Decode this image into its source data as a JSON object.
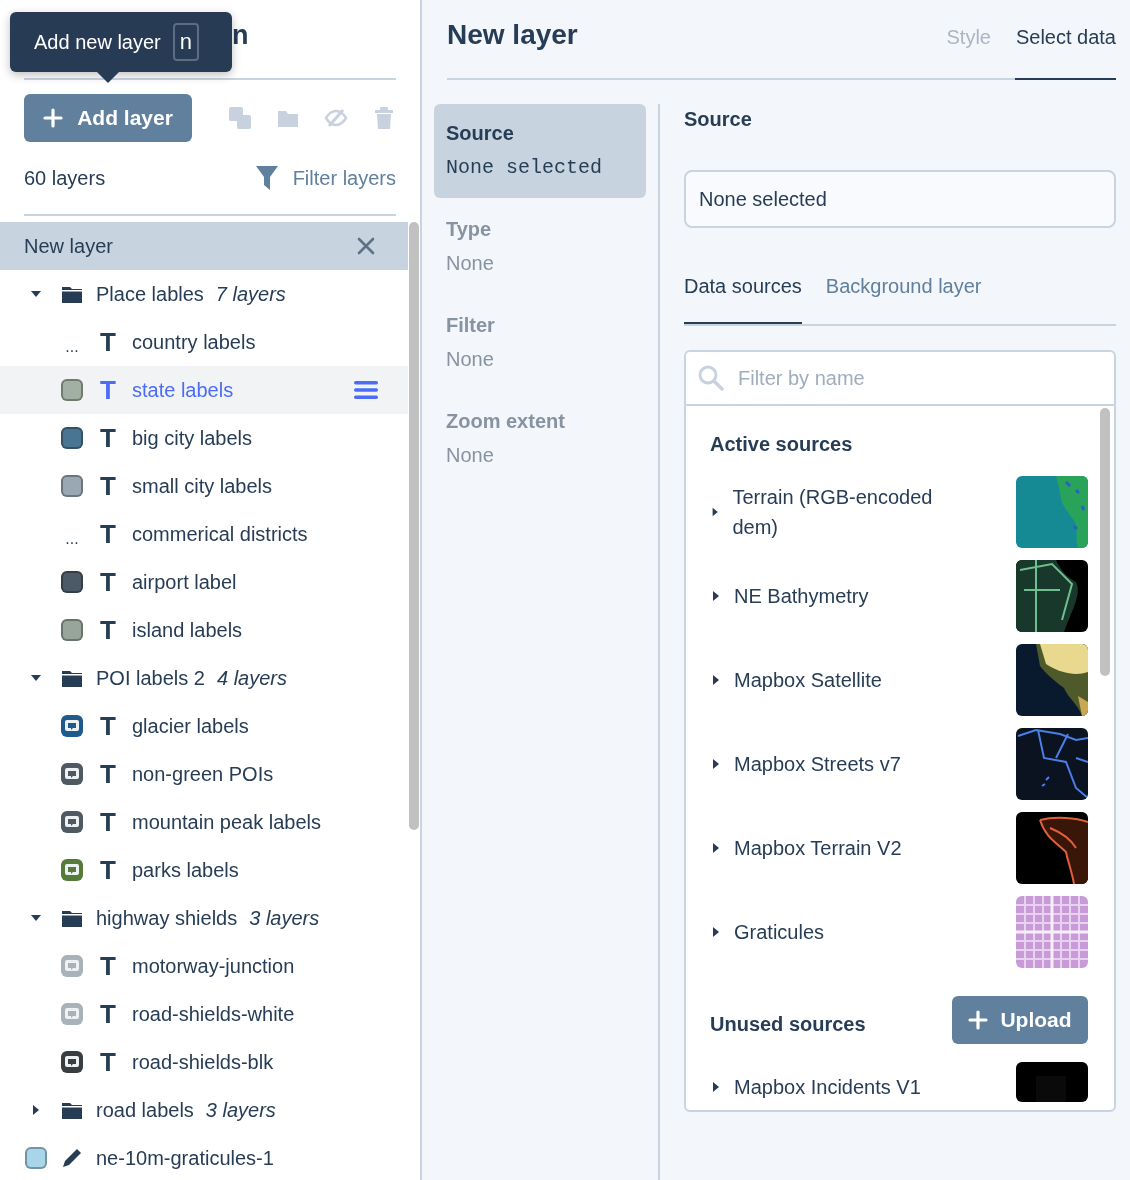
{
  "sidebar": {
    "title": "n",
    "tooltip": {
      "text": "Add new layer",
      "shortcut": "n"
    },
    "add_button": {
      "label": "Add layer"
    },
    "toolbar": [
      {
        "kind": "duplicate",
        "disabled": true
      },
      {
        "kind": "folder",
        "disabled": true
      },
      {
        "kind": "hide",
        "disabled": true
      },
      {
        "kind": "delete",
        "disabled": true
      }
    ],
    "layer_count": "60 layers",
    "filter": {
      "label": "Filter layers"
    },
    "new_layer": {
      "label": "New layer"
    },
    "tree": [
      {
        "kind": "group",
        "name": "Place lables",
        "count": "7 layers",
        "expanded": true,
        "children": [
          {
            "kind": "layer",
            "swatch": {
              "kind": "text",
              "marker": "..."
            },
            "icon": {
              "kind": "symbol",
              "glyph": "T"
            },
            "name": "country labels",
            "selected": false
          },
          {
            "kind": "layer",
            "swatch": {
              "kind": "fill",
              "color": "#a2afa3"
            },
            "icon": {
              "kind": "symbol",
              "glyph": "T"
            },
            "name": "state labels",
            "selected": true
          },
          {
            "kind": "layer",
            "swatch": {
              "kind": "fill",
              "color": "#4a7592"
            },
            "icon": {
              "kind": "symbol",
              "glyph": "T"
            },
            "name": "big city labels",
            "selected": false
          },
          {
            "kind": "layer",
            "swatch": {
              "kind": "fill",
              "color": "#9aa8b3"
            },
            "icon": {
              "kind": "symbol",
              "glyph": "T"
            },
            "name": "small city labels",
            "selected": false
          },
          {
            "kind": "layer",
            "swatch": {
              "kind": "text",
              "marker": "..."
            },
            "icon": {
              "kind": "symbol",
              "glyph": "T"
            },
            "name": "commerical districts",
            "selected": false
          },
          {
            "kind": "layer",
            "swatch": {
              "kind": "fill",
              "color": "#4c5966"
            },
            "icon": {
              "kind": "symbol",
              "glyph": "T"
            },
            "name": "airport label",
            "selected": false
          },
          {
            "kind": "layer",
            "swatch": {
              "kind": "fill",
              "color": "#98a59a"
            },
            "icon": {
              "kind": "symbol",
              "glyph": "T"
            },
            "name": "island labels",
            "selected": false
          }
        ]
      },
      {
        "kind": "group",
        "name": "POI labels 2",
        "count": "4 layers",
        "expanded": true,
        "children": [
          {
            "kind": "layer",
            "swatch": {
              "kind": "sprite",
              "color": "#1f5a8c"
            },
            "icon": {
              "kind": "symbol",
              "glyph": "T"
            },
            "name": "glacier labels",
            "selected": false
          },
          {
            "kind": "layer",
            "swatch": {
              "kind": "sprite",
              "color": "#4f5963"
            },
            "icon": {
              "kind": "symbol",
              "glyph": "T"
            },
            "name": "non-green POIs",
            "selected": false
          },
          {
            "kind": "layer",
            "swatch": {
              "kind": "sprite",
              "color": "#4f5963"
            },
            "icon": {
              "kind": "symbol",
              "glyph": "T"
            },
            "name": "mountain peak labels",
            "selected": false
          },
          {
            "kind": "layer",
            "swatch": {
              "kind": "sprite",
              "color": "#557a3a"
            },
            "icon": {
              "kind": "symbol",
              "glyph": "T"
            },
            "name": "parks labels",
            "selected": false
          }
        ]
      },
      {
        "kind": "group",
        "name": "highway shields",
        "count": "3 layers",
        "expanded": true,
        "children": [
          {
            "kind": "layer",
            "swatch": {
              "kind": "sprite",
              "color": "#a9b1b9"
            },
            "icon": {
              "kind": "symbol",
              "glyph": "T"
            },
            "name": "motorway-junction",
            "selected": false
          },
          {
            "kind": "layer",
            "swatch": {
              "kind": "sprite",
              "color": "#a9b1b9"
            },
            "icon": {
              "kind": "symbol",
              "glyph": "T"
            },
            "name": "road-shields-white",
            "selected": false
          },
          {
            "kind": "layer",
            "swatch": {
              "kind": "sprite",
              "color": "#3a3d40"
            },
            "icon": {
              "kind": "symbol",
              "glyph": "T"
            },
            "name": "road-shields-blk",
            "selected": false
          }
        ]
      },
      {
        "kind": "group",
        "name": "road labels",
        "count": "3 layers",
        "expanded": false
      },
      {
        "kind": "layer",
        "swatch": {
          "kind": "fill",
          "color": "#a8d5ea"
        },
        "icon": {
          "kind": "line"
        },
        "name": "ne-10m-graticules-1",
        "selected": false
      }
    ]
  },
  "panel": {
    "title": "New layer",
    "tabs": [
      {
        "label": "Style",
        "selected": false,
        "disabled": true
      },
      {
        "label": "Select data",
        "selected": true,
        "disabled": false
      }
    ],
    "steps": [
      {
        "label": "Source",
        "value": "None selected",
        "selected": true
      },
      {
        "label": "Type",
        "value": "None",
        "selected": false
      },
      {
        "label": "Filter",
        "value": "None",
        "selected": false
      },
      {
        "label": "Zoom extent",
        "value": "None",
        "selected": false
      }
    ],
    "source": {
      "heading": "Source",
      "field_value": "None selected",
      "tabs": [
        {
          "label": "Data sources",
          "selected": true
        },
        {
          "label": "Background layer",
          "selected": false
        }
      ],
      "search": {
        "placeholder": "Filter by name"
      },
      "active_heading": "Active sources",
      "active_sources": [
        {
          "name": "Terrain (RGB-encoded dem)",
          "expanded": false
        },
        {
          "name": "NE Bathymetry",
          "expanded": false
        },
        {
          "name": "Mapbox Satellite",
          "expanded": false
        },
        {
          "name": "Mapbox Streets v7",
          "expanded": false
        },
        {
          "name": "Mapbox Terrain V2",
          "expanded": false
        },
        {
          "name": "Graticules",
          "expanded": false
        }
      ],
      "unused_heading": "Unused sources",
      "upload_button": {
        "label": "Upload"
      },
      "unused_sources": [
        {
          "name": "Mapbox Incidents V1",
          "expanded": false
        }
      ]
    }
  }
}
